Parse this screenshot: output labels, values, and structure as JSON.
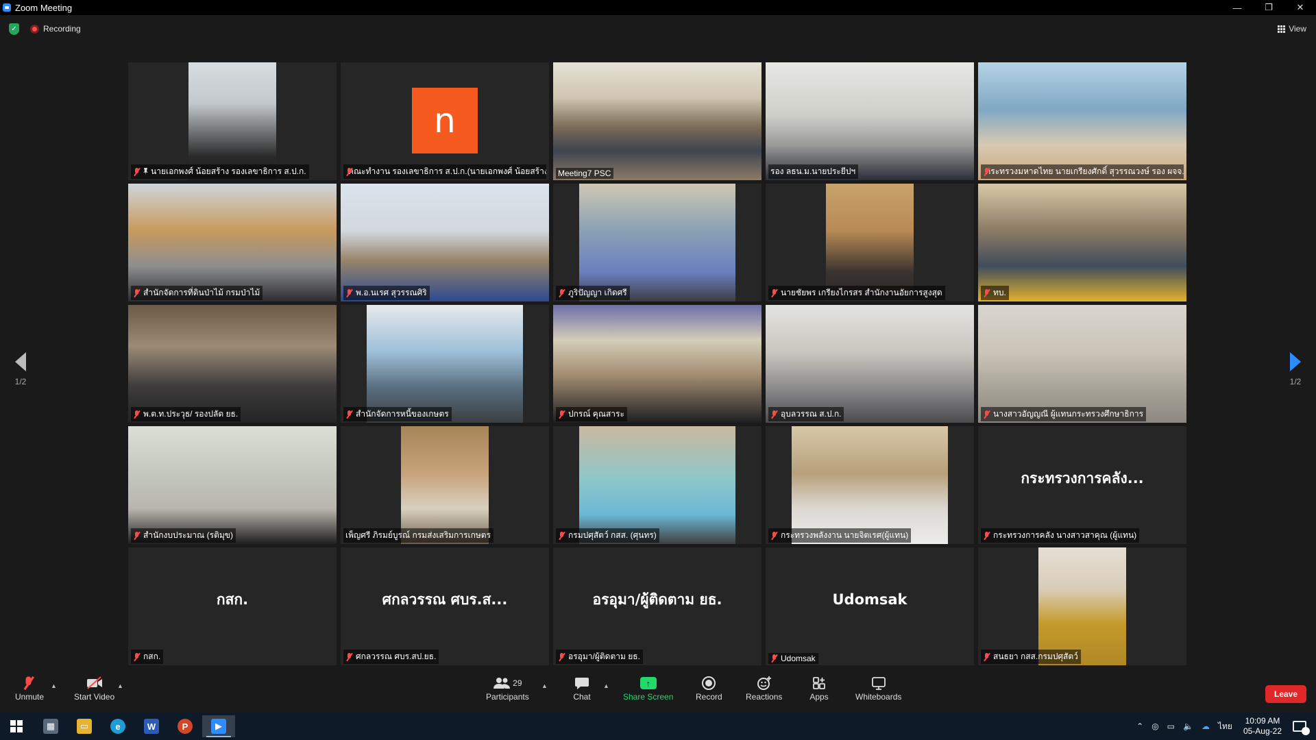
{
  "window": {
    "title": "Zoom Meeting",
    "min": "—",
    "restore": "❐",
    "close": "✕"
  },
  "topbar": {
    "recording_label": "Recording",
    "view_label": "View"
  },
  "pagination": {
    "left": "1/2",
    "right": "1/2"
  },
  "participants": [
    {
      "name": "นายเอกพงศ์ น้อยสร้าง รองเลขาธิการ ส.ป.ก.",
      "muted": true,
      "pinned": true,
      "bg": "linear-gradient(180deg,#d8dde0 0%,#c2c8cc 35%,#2a2a2a 80%,#1e1e1e 100%)",
      "video": "narrow"
    },
    {
      "name": "คณะทำงาน รองเลขาธิการ ส.ป.ก.(นายเอกพงศ์ น้อยสร้าง)",
      "muted": true,
      "avatar": "n"
    },
    {
      "name": "Meeting7 PSC",
      "muted": false,
      "active": true,
      "bg": "linear-gradient(180deg,#e6e2d6 0%,#cfc5b0 30%,#7b6b57 55%,#3f4450 75%,#8c7b66 100%)"
    },
    {
      "name": "รอง ลธน.ม.นายประยีปฯ",
      "muted": false,
      "bg": "linear-gradient(180deg,#e8e8e4 0%,#cfcfc9 45%,#9a9a98 70%,#2a2f3a 100%)"
    },
    {
      "name": "กระทรวงมหาดไทย นายเกรียงศักดิ์ สุวรรณวงษ์ รอง ผจจ.เพช...",
      "muted": true,
      "bg": "linear-gradient(180deg,#b6d3e6 0%,#7fa8c4 40%,#d8c9b2 70%,#c9a77d 100%)"
    },
    {
      "name": "สำนักจัดการที่ดินป่าไม้ กรมป่าไม้",
      "muted": true,
      "bg": "linear-gradient(180deg,#cfd5db 0%,#c79a5c 40%,#8d8e8f 70%,#2e2e30 100%)"
    },
    {
      "name": "พ.อ.นเรศ สุวรรณศิริ",
      "muted": true,
      "bg": "linear-gradient(180deg,#dbe3ec 0%,#d2d8de 40%,#98856a 65%,#2c4a8f 100%)"
    },
    {
      "name": "ภูริปัญญา เกิดศรี",
      "muted": true,
      "bg": "linear-gradient(180deg,#cfc8b5 0%,#8aa0b4 40%,#6b7fc0 75%,#3d3d42 100%)",
      "video": "mid"
    },
    {
      "name": "นายชัยพร เกรียงไกรสร สำนักงานอัยการสูงสุด",
      "muted": true,
      "bg": "linear-gradient(180deg,#c9a36c 0%,#b88a54 40%,#3a3330 75%,#2a2628 100%)",
      "video": "narrow"
    },
    {
      "name": "ทบ.",
      "muted": true,
      "bg": "linear-gradient(180deg,#d9c8a6 0%,#8c7a64 40%,#3f4d5c 70%,#e3b12e 100%)"
    },
    {
      "name": "พ.ต.ท.ประวุธ/ รองปลัด ยธ.",
      "muted": true,
      "bg": "linear-gradient(180deg,#6c5a44 0%,#9b8a74 35%,#3c3a3c 70%,#242424 100%)"
    },
    {
      "name": "สำนักจัดการหนี้ของเกษตร",
      "muted": true,
      "bg": "linear-gradient(180deg,#e6e9ec 0%,#9dbfd9 40%,#5a6f80 70%,#3b3f42 100%)",
      "video": "mid"
    },
    {
      "name": "ปกรณ์ คุณสาระ",
      "muted": true,
      "bg": "linear-gradient(180deg,#6d70a8 0%,#d4cdb8 30%,#a28c70 60%,#1e1e22 100%)"
    },
    {
      "name": "อุบลวรรณ ส.ป.ก.",
      "muted": true,
      "bg": "linear-gradient(180deg,#e4e4e0 0%,#c9c6bf 40%,#8d8d8e 70%,#4b4b4e 100%)"
    },
    {
      "name": "นางสาวอัญญณี ผู้แทนกระทรวงศึกษาธิการ",
      "muted": true,
      "bg": "linear-gradient(180deg,#d9d5cf 0%,#cbc4b8 40%,#a9a49a 70%,#8c8780 100%)"
    },
    {
      "name": "สำนักงบประมาณ (รติมุข)",
      "muted": true,
      "bg": "linear-gradient(180deg,#dcdfd6 0%,#c3c7bd 40%,#b9b5ad 70%,#1f1f1f 100%)"
    },
    {
      "name": "เพ็ญศรี ภิรมย์บูรณ์ กรมส่งเสริมการเกษตร",
      "muted": false,
      "bg": "linear-gradient(180deg,#a68558 0%,#c7a27a 40%,#d9d1c0 70%,#6b5d4c 100%)",
      "video": "narrow"
    },
    {
      "name": "กรมปศุสัตว์ กสส. (ศุนทร)",
      "muted": true,
      "bg": "linear-gradient(180deg,#c9b9a0 0%,#8ec7c9 45%,#6bb8d6 75%,#404040 100%)",
      "video": "mid"
    },
    {
      "name": "กระทรวงพลังงาน นายจิตเรศ(ผู้แทน)",
      "muted": true,
      "bg": "linear-gradient(180deg,#d8c8a8 0%,#b7a07a 40%,#dcd9d2 70%,#ececec 100%)",
      "video": "mid"
    },
    {
      "name": "กระทรวงการคลัง นางสาวสาคุณ (ผู้แทน)",
      "muted": true,
      "label": "กระทรวงการคลัง..."
    },
    {
      "name": "กสก.",
      "muted": true,
      "label": "กสก."
    },
    {
      "name": "ศกลวรรณ ศบร.สป.ยธ.",
      "muted": true,
      "label": "ศกลวรรณ ศบร.ส..."
    },
    {
      "name": "อรอุมา/ผู้ติดตาม ยธ.",
      "muted": true,
      "label": "อรอุมา/ผู้ติดตาม ยธ."
    },
    {
      "name": "Udomsak",
      "muted": true,
      "label": "Udomsak"
    },
    {
      "name": "สนธยา กสส.กรมปศุสัตว์",
      "muted": true,
      "bg": "linear-gradient(180deg,#e6dfd4 0%,#d9cdb8 35%,#c49a2a 65%,#b08826 100%)",
      "video": "narrow"
    }
  ],
  "toolbar": {
    "unmute": "Unmute",
    "start_video": "Start Video",
    "participants": "Participants",
    "participants_count": "29",
    "chat": "Chat",
    "share_screen": "Share Screen",
    "record": "Record",
    "reactions": "Reactions",
    "apps": "Apps",
    "whiteboards": "Whiteboards",
    "leave": "Leave"
  },
  "taskbar": {
    "lang": "ไทย",
    "time": "10:09 AM",
    "date": "05-Aug-22",
    "notif_count": "1"
  },
  "colors": {
    "accent": "#2d8cff",
    "active_speaker": "#f3f57a",
    "leave": "#e02828",
    "share": "#23d96c",
    "muted": "#ff4a4a"
  }
}
